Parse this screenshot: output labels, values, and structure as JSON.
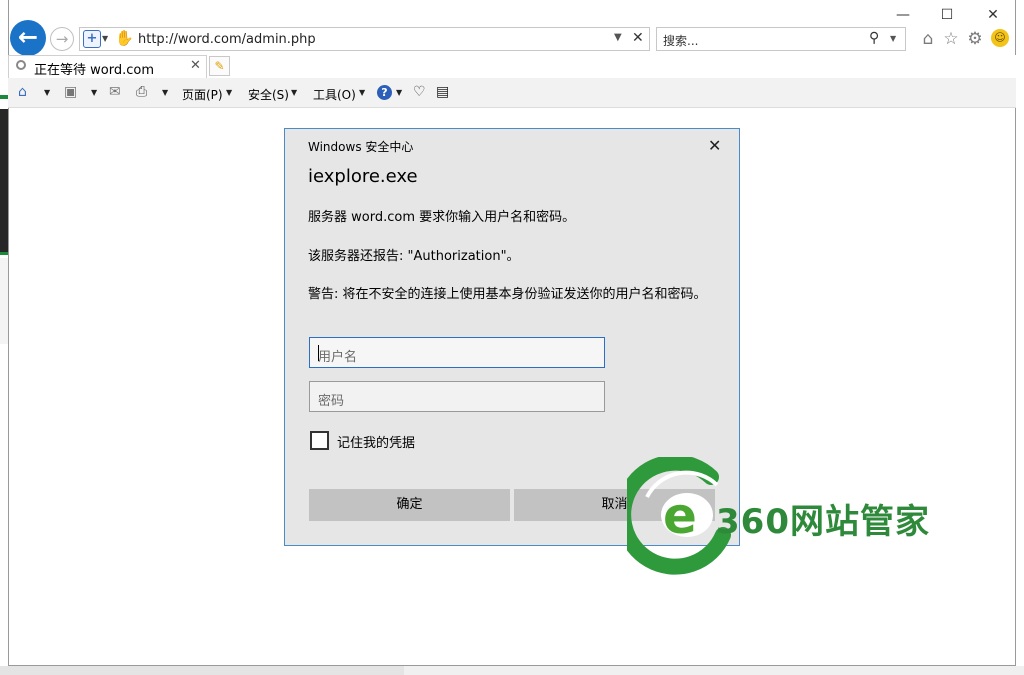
{
  "browser": {
    "address_url": "http://word.com/admin.php",
    "search_placeholder": "搜索...",
    "tab_title": "正在等待 word.com",
    "window_controls": [
      "minimize",
      "maximize",
      "close"
    ],
    "right_icons": [
      "home-icon",
      "star-icon",
      "gear-icon",
      "smiley-icon"
    ]
  },
  "command_bar": {
    "menus": [
      "页面(P)",
      "安全(S)",
      "工具(O)"
    ],
    "icons": [
      "home-icon",
      "rss-icon",
      "mail-icon",
      "print-icon",
      "help-icon",
      "bulb-icon",
      "research-icon"
    ]
  },
  "dialog": {
    "window_title": "Windows 安全中心",
    "app_name": "iexplore.exe",
    "message_1": "服务器 word.com 要求你输入用户名和密码。",
    "message_2": "该服务器还报告: \"Authorization\"。",
    "message_3": "警告: 将在不安全的连接上使用基本身份验证发送你的用户名和密码。",
    "username_placeholder": "用户名",
    "password_placeholder": "密码",
    "remember_label": "记住我的凭据",
    "remember_checked": false,
    "ok_label": "确定",
    "cancel_label": "取消"
  },
  "watermark": {
    "text": "360网站管家",
    "color": "#2e8a3a"
  },
  "colors": {
    "accent_blue": "#1a73c7",
    "dialog_border": "#4a8cc8",
    "input_focus_border": "#2a6fc4"
  }
}
